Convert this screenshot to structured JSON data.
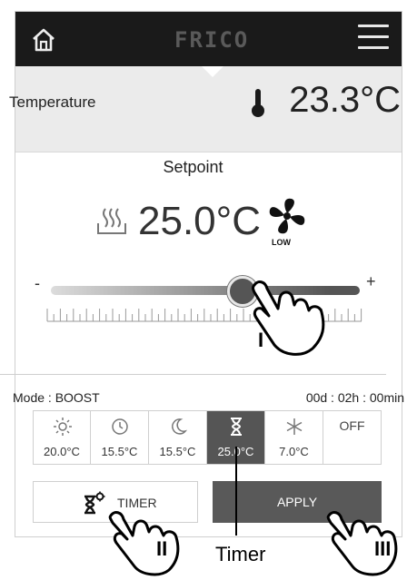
{
  "header": {
    "logo_text": "FRICO",
    "home_icon": "home-icon",
    "menu_icon": "hamburger-menu-icon"
  },
  "temperature": {
    "label": "Temperature",
    "value": "23.3°C",
    "icon": "thermometer-icon"
  },
  "setpoint": {
    "label": "Setpoint",
    "value": "25.0°C",
    "heat_icon": "heat-waves-icon",
    "fan_icon": "fan-icon",
    "fan_speed": "LOW"
  },
  "slider": {
    "minus_label": "-",
    "plus_label": "+",
    "level_fraction": 0.62
  },
  "mode_bar": {
    "mode_text": "Mode : BOOST",
    "timer_text": "00d : 02h : 00min"
  },
  "modes": [
    {
      "icon": "sun-icon",
      "value": "20.0°C"
    },
    {
      "icon": "clock-icon",
      "value": "15.5°C"
    },
    {
      "icon": "moon-icon",
      "value": "15.5°C"
    },
    {
      "icon": "hourglass-icon",
      "value": "25.0°C",
      "active": true
    },
    {
      "icon": "snowflake-icon",
      "value": "7.0°C"
    },
    {
      "icon": "",
      "value": "OFF"
    }
  ],
  "buttons": {
    "timer_label": "TIMER",
    "apply_label": "APPLY"
  },
  "annotations": {
    "callout_1": "I",
    "callout_2": "II",
    "callout_3": "III",
    "timer_label": "Timer"
  }
}
